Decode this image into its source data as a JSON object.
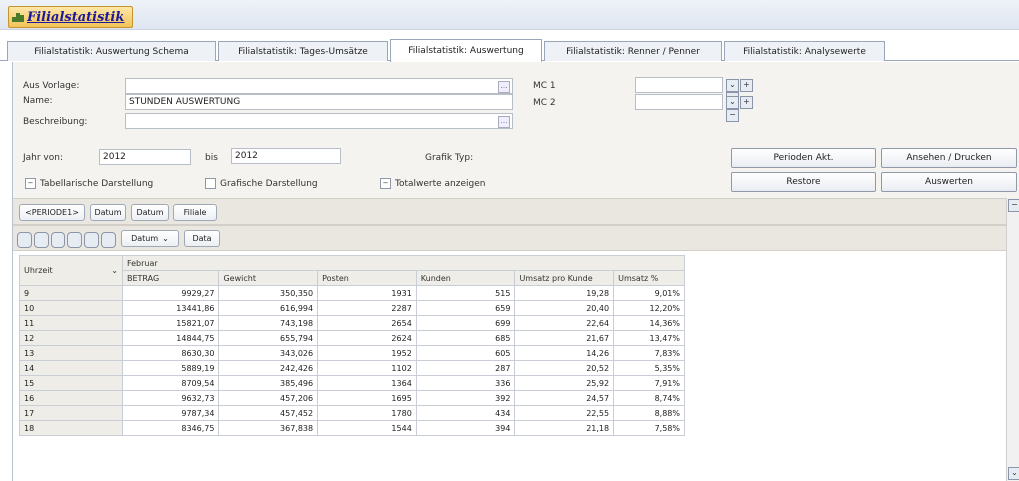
{
  "window": {
    "title": "Filialstatistik"
  },
  "tabs": [
    {
      "label": "Filialstatistik: Auswertung Schema"
    },
    {
      "label": "Filialstatistik: Tages-Umsätze"
    },
    {
      "label": "Filialstatistik: Auswertung",
      "active": true
    },
    {
      "label": "Filialstatistik: Renner / Penner"
    },
    {
      "label": "Filialstatistik: Analysewerte"
    }
  ],
  "form": {
    "aus_vorlage_label": "Aus Vorlage:",
    "aus_vorlage_value": "",
    "name_label": "Name:",
    "name_value": "STUNDEN AUSWERTUNG",
    "beschreibung_label": "Beschreibung:",
    "beschreibung_value": "",
    "mc1_label": "MC 1",
    "mc2_label": "MC 2",
    "mc1_value": "",
    "mc2_value": "",
    "jahr_von_label": "Jahr von:",
    "jahr_von_value": "2012",
    "bis_label": "bis",
    "bis_value": "2012",
    "grafik_typ_label": "Grafik Typ:",
    "tabellarische_label": "Tabellarische Darstellung",
    "grafische_label": "Grafische Darstellung",
    "totalwerte_label": "Totalwerte anzeigen"
  },
  "buttons": {
    "perioden_akt": "Perioden Akt.",
    "ansehen_drucken": "Ansehen / Drucken",
    "restore": "Restore",
    "auswerten": "Auswerten"
  },
  "group_pills": {
    "periode": "<PERIODE1>",
    "datum1": "Datum",
    "datum2": "Datum",
    "filiale": "Filiale"
  },
  "data_pills": {
    "datum": "Datum",
    "data": "Data"
  },
  "grid": {
    "row_header_label": "Uhrzeit",
    "group_header": "Februar",
    "columns": [
      "BETRAG",
      "Gewicht",
      "Posten",
      "Kunden",
      "Umsatz pro Kunde",
      "Umsatz %"
    ],
    "rows": [
      {
        "hour": "9",
        "values": [
          "9929,27",
          "350,350",
          "1931",
          "515",
          "19,28",
          "9,01%"
        ]
      },
      {
        "hour": "10",
        "values": [
          "13441,86",
          "616,994",
          "2287",
          "659",
          "20,40",
          "12,20%"
        ]
      },
      {
        "hour": "11",
        "values": [
          "15821,07",
          "743,198",
          "2654",
          "699",
          "22,64",
          "14,36%"
        ]
      },
      {
        "hour": "12",
        "values": [
          "14844,75",
          "655,794",
          "2624",
          "685",
          "21,67",
          "13,47%"
        ]
      },
      {
        "hour": "13",
        "values": [
          "8630,30",
          "343,026",
          "1952",
          "605",
          "14,26",
          "7,83%"
        ]
      },
      {
        "hour": "14",
        "values": [
          "5889,19",
          "242,426",
          "1102",
          "287",
          "20,52",
          "5,35%"
        ]
      },
      {
        "hour": "15",
        "values": [
          "8709,54",
          "385,496",
          "1364",
          "336",
          "25,92",
          "7,91%"
        ]
      },
      {
        "hour": "16",
        "values": [
          "9632,73",
          "457,206",
          "1695",
          "392",
          "24,57",
          "8,74%"
        ]
      },
      {
        "hour": "17",
        "values": [
          "9787,34",
          "457,452",
          "1780",
          "434",
          "22,55",
          "8,88%"
        ]
      },
      {
        "hour": "18",
        "values": [
          "8346,75",
          "367,838",
          "1544",
          "394",
          "21,18",
          "7,58%"
        ]
      }
    ]
  }
}
